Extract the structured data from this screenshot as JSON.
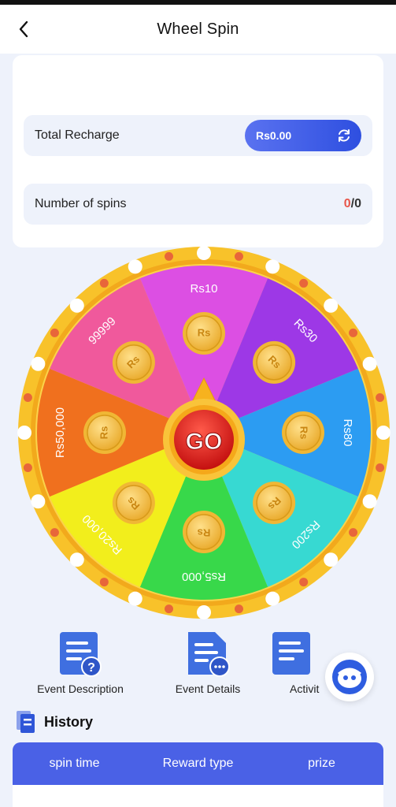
{
  "header": {
    "title": "Wheel Spin",
    "back_icon": "chevron-left-icon"
  },
  "summary": {
    "total_recharge_label": "Total Recharge",
    "total_recharge_value": "Rs0.00",
    "refresh_icon": "refresh-icon",
    "spins_label": "Number of spins",
    "spins_used": "0",
    "spins_separator": "/",
    "spins_total": "0"
  },
  "wheel": {
    "go_label": "GO",
    "coin_symbol": "Rs",
    "segments": [
      {
        "label": "Rs10",
        "color": "#dc4fe3"
      },
      {
        "label": "Rs30",
        "color": "#9d38e6"
      },
      {
        "label": "Rs80",
        "color": "#2c9cf2"
      },
      {
        "label": "Rs200",
        "color": "#37d9d2"
      },
      {
        "label": "Rs5,000",
        "color": "#38d84a"
      },
      {
        "label": "Rs20,000",
        "color": "#f2ee1c"
      },
      {
        "label": "Rs50,000",
        "color": "#f0701e"
      },
      {
        "label": "99999",
        "color": "#f0599c"
      }
    ]
  },
  "actions": [
    {
      "label": "Event Description",
      "icon": "document-help-icon"
    },
    {
      "label": "Event Details",
      "icon": "document-more-icon"
    },
    {
      "label": "Activit",
      "icon": "document-icon"
    }
  ],
  "support_icon": "customer-service-icon",
  "history": {
    "title": "History",
    "icon": "history-icon",
    "columns": [
      "spin time",
      "Reward type",
      "prize"
    ]
  },
  "colors": {
    "accent": "#4a61e6",
    "background": "#eef2fb",
    "go_button": "#e0201e"
  }
}
